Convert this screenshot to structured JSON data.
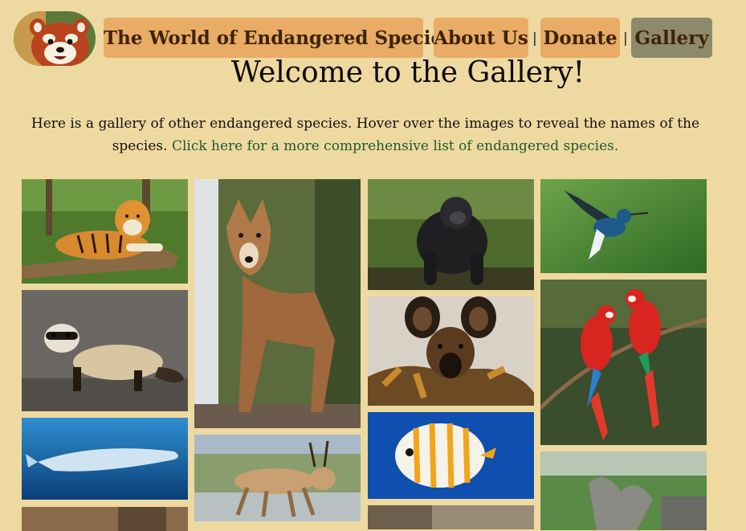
{
  "nav": {
    "site_title": "The World of Endangered Species",
    "about": "About Us",
    "separator": "|",
    "donate": "Donate",
    "gallery": "Gallery"
  },
  "page": {
    "heading": "Welcome to the Gallery!",
    "intro_text": "Here is a gallery of other endangered species. Hover over the images to reveal the names of the species.",
    "intro_link": "Click here for a more comprehensive list of endangered species."
  },
  "colors": {
    "page_background": "#eed9a1",
    "nav_button": "#e8ac66",
    "nav_button_active": "#8c8a6a",
    "nav_text": "#3f2308",
    "link": "#1f5a2c"
  },
  "gallery": {
    "tiles": [
      {
        "icon": "tiger-photo"
      },
      {
        "icon": "red-wolf-photo"
      },
      {
        "icon": "gorilla-photo"
      },
      {
        "icon": "hummingbird-photo"
      },
      {
        "icon": "black-footed-ferret-photo"
      },
      {
        "icon": "african-wild-dog-photo"
      },
      {
        "icon": "macaws-photo"
      },
      {
        "icon": "blue-whale-photo"
      },
      {
        "icon": "saiga-antelope-photo"
      },
      {
        "icon": "butterflyfish-photo"
      }
    ]
  }
}
